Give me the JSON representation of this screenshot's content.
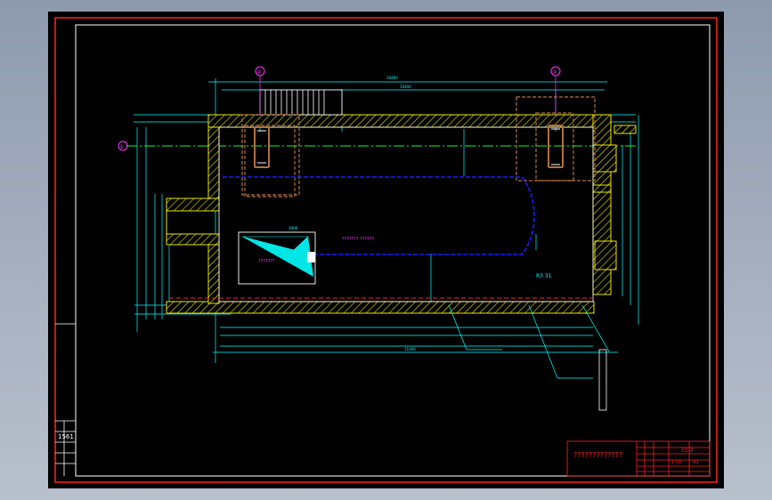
{
  "drawing": {
    "title_block_text": "?????????????",
    "drawing_no": "02-2",
    "sidebar_label": "1561",
    "sheet_marks": [
      "1:50",
      "A3"
    ]
  },
  "axis_bubbles": [
    "①",
    "②",
    "②"
  ],
  "annotations": {
    "room_note": "??????? ??????",
    "equipment_label": "???????",
    "radius_note": "R3 31",
    "dim_main": "10400",
    "dim_top": "10400",
    "dim_bottom": "11600",
    "dim_small": "3000"
  },
  "colors": {
    "frame_red": "#ff2222",
    "wall_yellow": "#ffff00",
    "dim_cyan": "#00ffff",
    "centerline_green": "#00ff33",
    "pool_blue": "#1a1aff",
    "equip_brown": "#b07040",
    "text_magenta": "#ff33ff"
  }
}
